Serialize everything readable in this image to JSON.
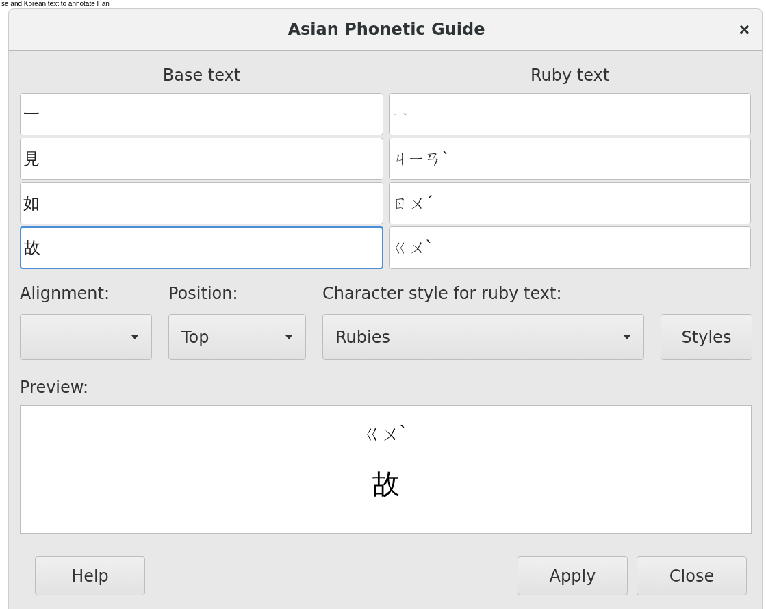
{
  "background_text": "se and Korean text to annotate Han",
  "window": {
    "title": "Asian Phonetic Guide",
    "close": "×"
  },
  "columns": [
    "Base text",
    "Ruby text"
  ],
  "rows": [
    {
      "base": "一",
      "ruby": "ㄧ",
      "focused": false
    },
    {
      "base": "見",
      "ruby": "ㄐㄧㄢˋ",
      "focused": false
    },
    {
      "base": "如",
      "ruby": "ㄖㄨˊ",
      "focused": false
    },
    {
      "base": "故",
      "ruby": "ㄍㄨˋ",
      "focused": true
    }
  ],
  "options": [
    {
      "kind": "dropdown",
      "label": "Alignment:"
    },
    {
      "kind": "dropdown",
      "label": "Position:",
      "value": "Top"
    },
    {
      "kind": "dropdown",
      "label": "Character style for ruby text:",
      "value": "Rubies"
    },
    {
      "kind": "button",
      "value": "Styles"
    }
  ],
  "preview": {
    "label": "Preview:",
    "ruby": "ㄍㄨˋ",
    "base": "故"
  },
  "left_buttons": [
    "Help"
  ],
  "right_buttons": [
    "Apply",
    "Close"
  ]
}
